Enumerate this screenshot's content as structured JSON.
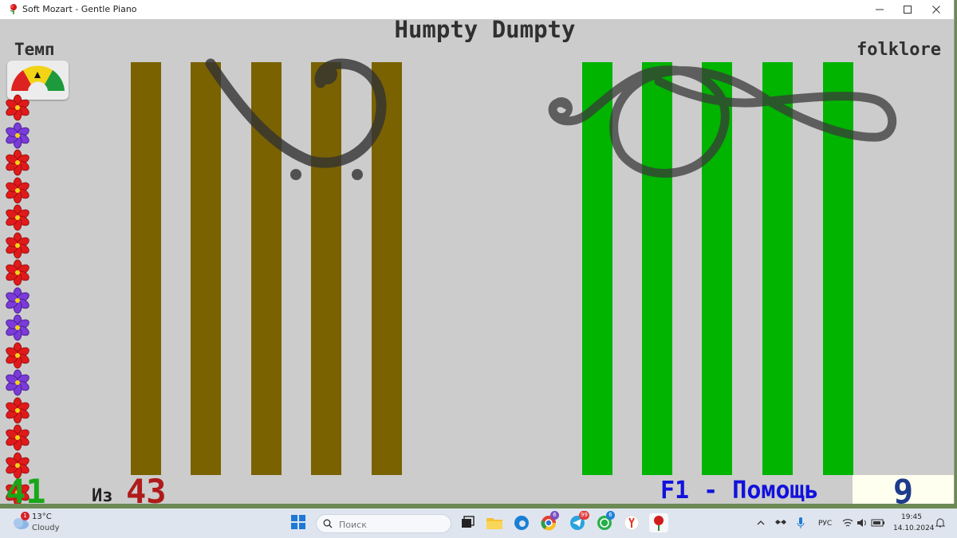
{
  "window": {
    "title": "Soft Mozart - Gentle Piano"
  },
  "song": {
    "title": "Humpty Dumpty",
    "genre": "folklore"
  },
  "tempo": {
    "label": "Темп"
  },
  "flowers": [
    "red",
    "purple",
    "red",
    "red",
    "red",
    "red",
    "red",
    "purple",
    "purple",
    "red",
    "purple",
    "red",
    "red",
    "red",
    "red"
  ],
  "staves": {
    "bass_color": "#7a6200",
    "treble_color": "#00b400",
    "clef_color": "#3c3c3c"
  },
  "progress": {
    "current": "41",
    "of_label": "Из",
    "total": "43"
  },
  "help": {
    "label": "F1 - Помощь"
  },
  "level": {
    "value": "9"
  },
  "taskbar": {
    "weather_badge": "1",
    "weather_temp": "13°C",
    "weather_text": "Cloudy",
    "search_placeholder": "Поиск",
    "chrome_badge": "6",
    "telegram_badge": "99",
    "whatsapp_badge": "6",
    "language": "РУС",
    "time": "19:45",
    "date": "14.10.2024"
  }
}
